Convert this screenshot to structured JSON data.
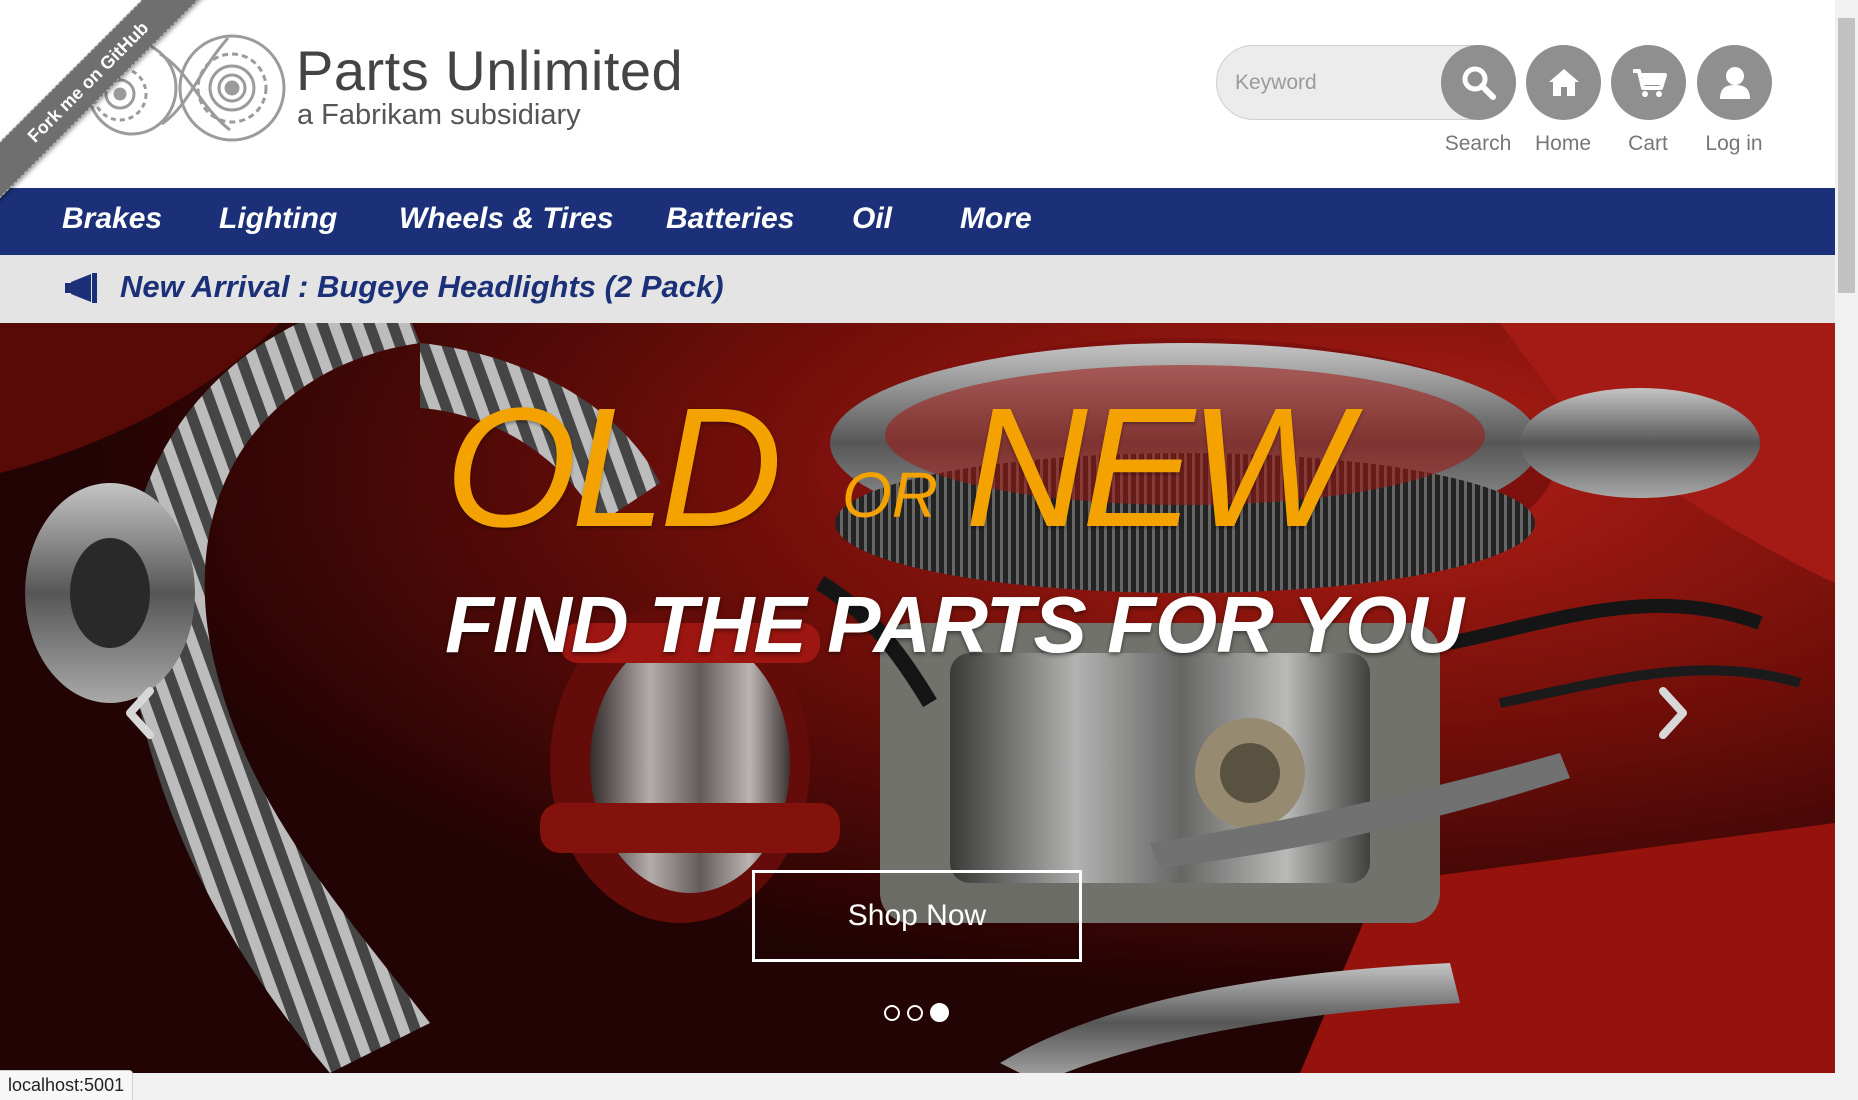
{
  "ribbon": {
    "label": "Fork me on GitHub"
  },
  "brand": {
    "title": "Parts Unlimited",
    "subtitle": "a Fabrikam subsidiary"
  },
  "search": {
    "placeholder": "Keyword",
    "label": "Search",
    "icon": "search-icon"
  },
  "header_buttons": [
    {
      "label": "Home",
      "icon": "home-icon"
    },
    {
      "label": "Cart",
      "icon": "cart-icon"
    },
    {
      "label": "Log in",
      "icon": "user-icon"
    }
  ],
  "nav": {
    "items": [
      "Brakes",
      "Lighting",
      "Wheels & Tires",
      "Batteries",
      "Oil",
      "More"
    ]
  },
  "announcement": {
    "text": "New Arrival : Bugeye Headlights (2 Pack)",
    "icon": "megaphone-icon"
  },
  "hero": {
    "word_old": "OLD",
    "word_or": "OR",
    "word_new": "NEW",
    "tagline": "FIND THE PARTS FOR YOU",
    "cta": "Shop Now",
    "slide_count": 3,
    "active_slide": 3
  },
  "status_bar": {
    "url": "localhost:5001"
  },
  "colors": {
    "nav_bg": "#1b3078",
    "accent_orange": "#f4a200",
    "announce_bg": "#e4e4e4",
    "button_gray": "#8f8f8f"
  }
}
